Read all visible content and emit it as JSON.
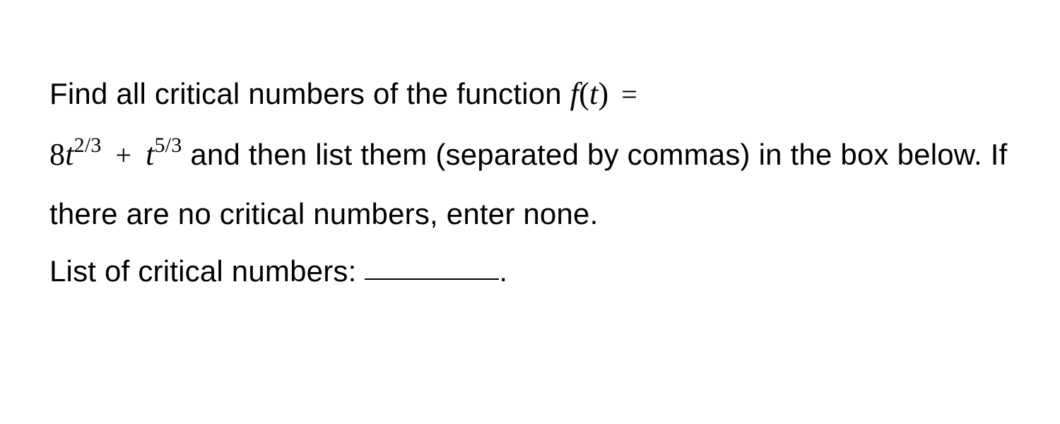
{
  "problem": {
    "line1_prefix": "Find all critical numbers of the function ",
    "func_lhs_f": "f",
    "func_lhs_paren_open": "(",
    "func_lhs_t": "t",
    "func_lhs_paren_close": ")",
    "eq_sign": "=",
    "term1_coef": "8",
    "term1_base": "t",
    "term1_exp": "2/3",
    "plus_sign": "+",
    "term2_base": "t",
    "term2_exp": "5/3",
    "line2_text": " and then list them (separated by commas) in the box below. If there are no critical numbers, enter none.",
    "line3_prefix": "List of critical numbers: ",
    "line3_suffix": "."
  }
}
